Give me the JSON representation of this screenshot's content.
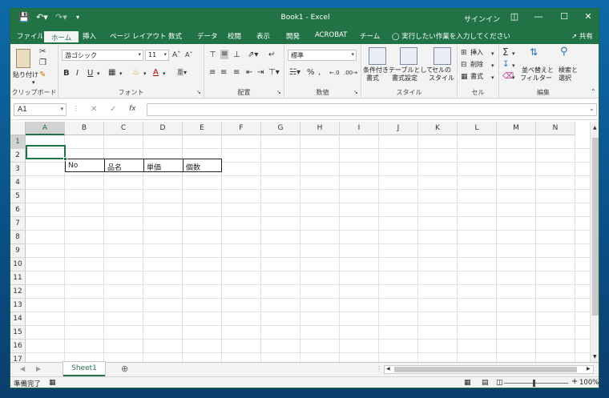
{
  "window": {
    "title": "Book1  -  Excel",
    "signin": "サインイン"
  },
  "tabs": [
    {
      "label": "ファイル"
    },
    {
      "label": "ホーム"
    },
    {
      "label": "挿入"
    },
    {
      "label": "ページ レイアウト"
    },
    {
      "label": "数式"
    },
    {
      "label": "データ"
    },
    {
      "label": "校閲"
    },
    {
      "label": "表示"
    },
    {
      "label": "開発"
    },
    {
      "label": "ACROBAT"
    },
    {
      "label": "チーム"
    }
  ],
  "tell_me": "実行したい作業を入力してください",
  "share": "共有",
  "ribbon": {
    "clipboard": {
      "paste": "貼り付け",
      "group": "クリップボード"
    },
    "font": {
      "name": "游ゴシック",
      "size": "11",
      "group": "フォント"
    },
    "alignment": {
      "group": "配置"
    },
    "number": {
      "format": "標準",
      "group": "数値"
    },
    "styles": {
      "conditional": [
        "条件付き",
        "書式"
      ],
      "table": [
        "テーブルとして",
        "書式設定"
      ],
      "cell": [
        "セルの",
        "スタイル"
      ],
      "group": "スタイル"
    },
    "cells": {
      "insert": "挿入",
      "delete": "削除",
      "format": "書式",
      "group": "セル"
    },
    "editing": {
      "sort": [
        "並べ替えと",
        "フィルター"
      ],
      "find": [
        "検索と",
        "選択"
      ],
      "group": "編集"
    }
  },
  "formula_bar": {
    "name_box": "A1",
    "content": ""
  },
  "columns": [
    "A",
    "B",
    "C",
    "D",
    "E",
    "F",
    "G",
    "H",
    "I",
    "J",
    "K",
    "L",
    "M",
    "N"
  ],
  "rows": [
    "1",
    "2",
    "3",
    "4",
    "5",
    "6",
    "7",
    "8",
    "9",
    "10",
    "11",
    "12",
    "13",
    "14",
    "15",
    "16",
    "17"
  ],
  "cells": {
    "B2": "No",
    "C2": "品名",
    "D2": "単価",
    "E2": "個数"
  },
  "sheet_tab": "Sheet1",
  "status": {
    "ready": "準備完了",
    "zoom": "100%"
  }
}
